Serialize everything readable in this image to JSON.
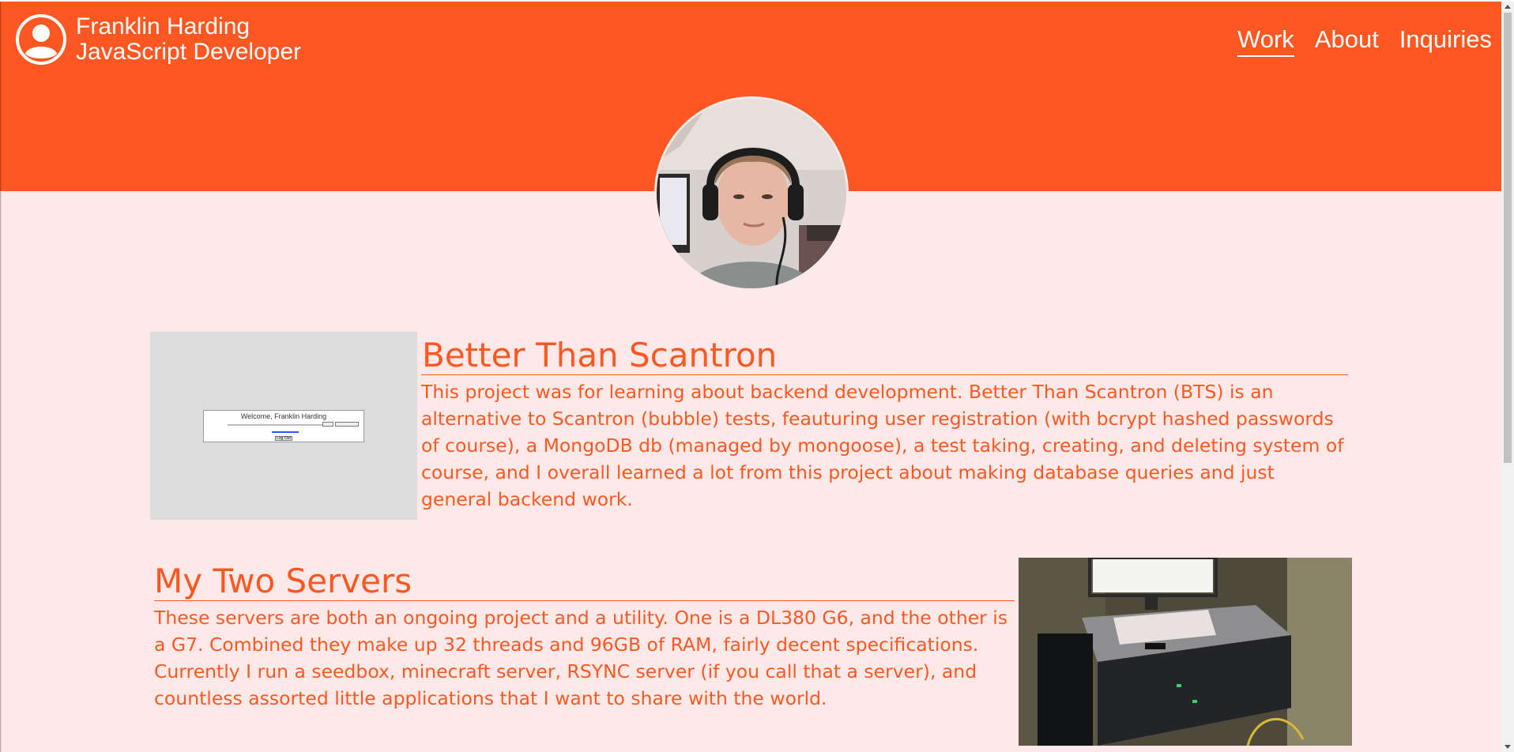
{
  "header": {
    "name": "Franklin Harding",
    "role": "JavaScript Developer",
    "nav": [
      {
        "label": "Work",
        "active": true
      },
      {
        "label": "About",
        "active": false
      },
      {
        "label": "Inquiries",
        "active": false
      }
    ],
    "background_color": "#ff5722"
  },
  "page": {
    "background_color": "#fde9e7",
    "accent_color": "#ff5722"
  },
  "icons": {
    "brand": "user-avatar-icon"
  },
  "projects": [
    {
      "title": "Better Than Scantron",
      "description": "This project was for learning about backend development. Better Than Scantron (BTS) is an alternative to Scantron (bubble) tests, feauturing user registration (with bcrypt hashed passwords of course), a MongoDB db (managed by mongoose), a test taking, creating, and deleting system of course, and I overall learned a lot from this project about making database queries and just general backend work.",
      "screenshot_caption": "Welcome, Franklin Harding",
      "screenshot_button": "Log Out"
    },
    {
      "title": "My Two Servers",
      "description": "These servers are both an ongoing project and a utility. One is a DL380 G6, and the other is a G7. Combined they make up 32 threads and 96GB of RAM, fairly decent specifications. Currently I run a seedbox, minecraft server, RSYNC server (if you call that a server), and countless assorted little applications that I want to share with the world."
    }
  ]
}
